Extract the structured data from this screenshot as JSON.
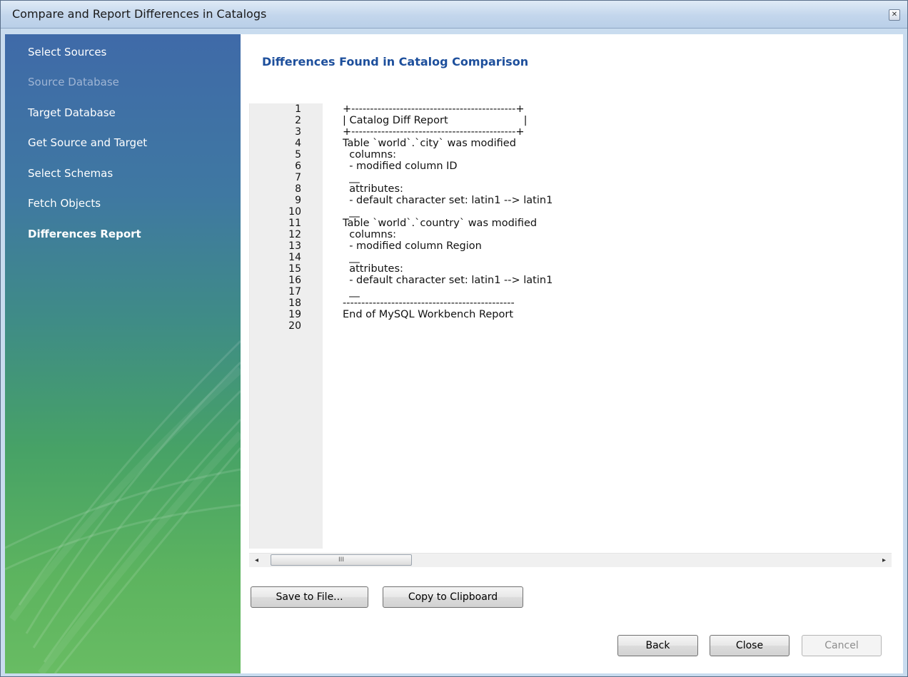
{
  "window": {
    "title": "Compare and Report Differences in Catalogs",
    "close_icon": "close-icon"
  },
  "sidebar": {
    "items": [
      {
        "label": "Select Sources",
        "state": "normal"
      },
      {
        "label": "Source Database",
        "state": "disabled"
      },
      {
        "label": "Target Database",
        "state": "normal"
      },
      {
        "label": "Get Source and Target",
        "state": "normal"
      },
      {
        "label": "Select Schemas",
        "state": "normal"
      },
      {
        "label": "Fetch Objects",
        "state": "normal"
      },
      {
        "label": "Differences Report",
        "state": "active"
      }
    ]
  },
  "main": {
    "heading": "Differences Found in Catalog Comparison",
    "report_lines": [
      "+--------------------------------------------+",
      "| Catalog Diff Report                       |",
      "+--------------------------------------------+",
      "Table `world`.`city` was modified",
      "  columns:",
      "  - modified column ID",
      "  __",
      "  attributes:",
      "  - default character set: latin1 --> latin1",
      "  __",
      "Table `world`.`country` was modified",
      "  columns:",
      "  - modified column Region",
      "  __",
      "  attributes:",
      "  - default character set: latin1 --> latin1",
      "  __",
      "----------------------------------------------",
      "End of MySQL Workbench Report",
      ""
    ],
    "line_numbers": [
      "1",
      "2",
      "3",
      "4",
      "5",
      "6",
      "7",
      "8",
      "9",
      "10",
      "11",
      "12",
      "13",
      "14",
      "15",
      "16",
      "17",
      "18",
      "19",
      "20"
    ],
    "scrollbar": {
      "left_arrow": "◂",
      "right_arrow": "▸",
      "thumb_grip": "III"
    }
  },
  "buttons": {
    "save_to_file": "Save to File...",
    "copy_to_clipboard": "Copy to Clipboard",
    "back": "Back",
    "close": "Close",
    "cancel": "Cancel"
  },
  "colors": {
    "heading": "#1d4f9c",
    "sidebar_top": "#3f6aa8",
    "sidebar_bottom": "#68bc63"
  }
}
